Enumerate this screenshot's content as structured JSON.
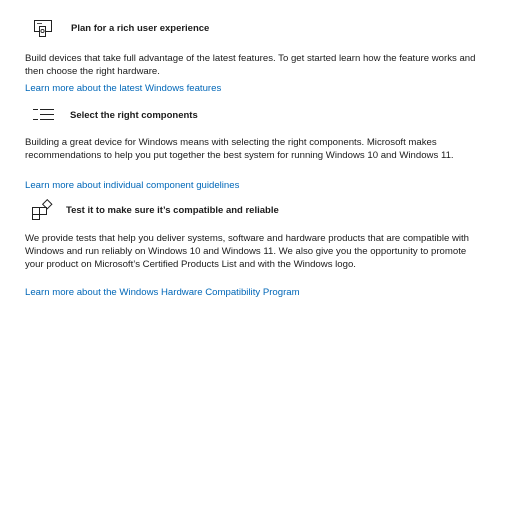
{
  "sections": [
    {
      "icon": "device-settings-icon",
      "heading": "Plan for a rich user experience",
      "body": "Build devices that take full advantage of the latest features. To get started learn how the feature works and then choose the right hardware.",
      "link": "Learn more about the latest Windows features"
    },
    {
      "icon": "checklist-icon",
      "heading": "Select the right components",
      "body": "Building a great device for Windows means with selecting the right components. Microsoft makes recommendations to help you put together the best system for running Windows 10 and Windows 11.",
      "link": "Learn more about individual component guidelines"
    },
    {
      "icon": "compatibility-apps-icon",
      "heading": "Test it to make sure it’s compatible and reliable",
      "body": "We provide tests that help you deliver systems, software and hardware products that are compatible with Windows and run reliably on Windows 10 and Windows 11. We also give you the opportunity to promote your product on Microsoft’s Certified Products List and with the Windows logo.",
      "link": "Learn more about the Windows Hardware Compatibility Program"
    }
  ]
}
